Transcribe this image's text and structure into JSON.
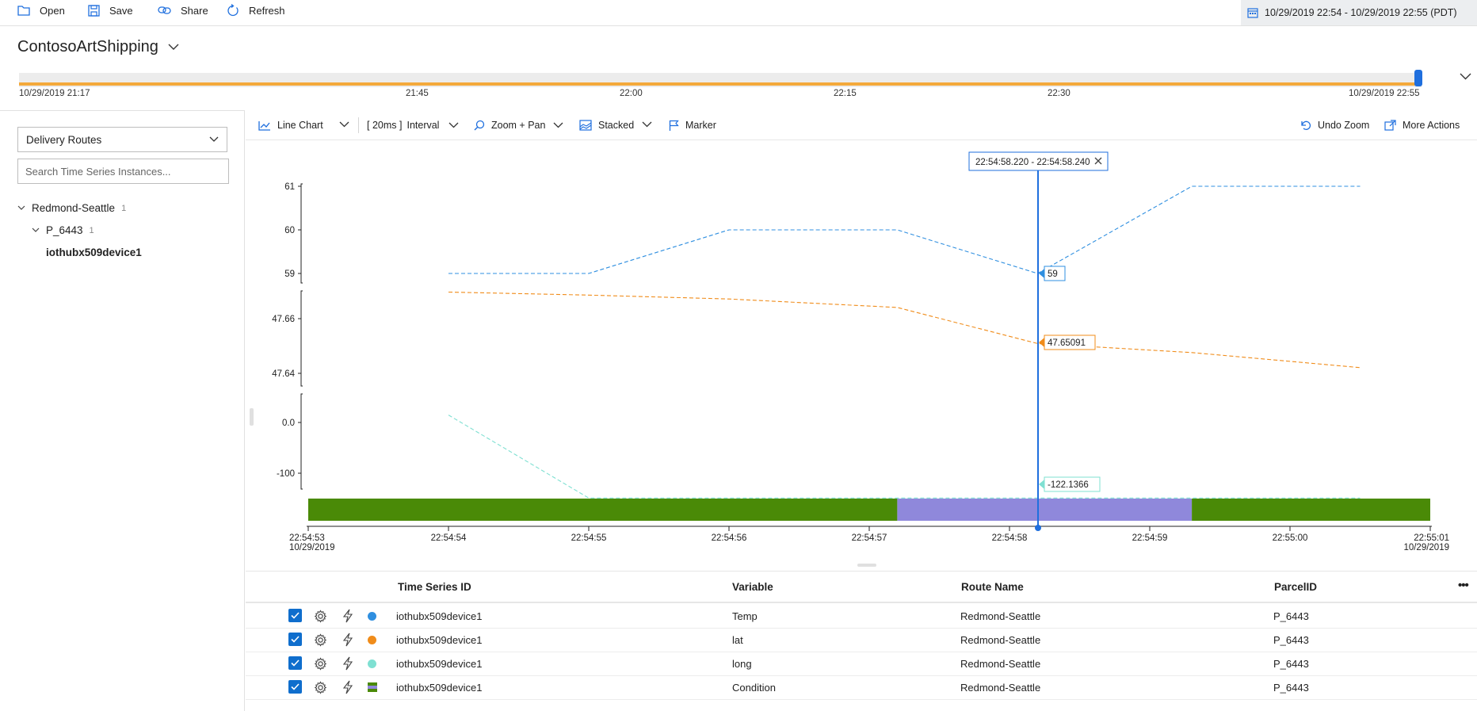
{
  "toolbar": {
    "open": "Open",
    "save": "Save",
    "share": "Share",
    "refresh": "Refresh",
    "date_range": "10/29/2019 22:54 - 10/29/2019 22:55 (PDT)"
  },
  "environment": {
    "name": "ContosoArtShipping"
  },
  "availability": {
    "labels": [
      "10/29/2019 21:17",
      "21:45",
      "22:00",
      "22:15",
      "22:30",
      "10/29/2019 22:55"
    ]
  },
  "left_panel": {
    "hierarchy": "Delivery Routes",
    "search_placeholder": "Search Time Series Instances...",
    "tree": [
      {
        "label": "Redmond-Seattle",
        "count": "1"
      },
      {
        "label": "P_6443",
        "count": "1"
      },
      {
        "label": "iothubx509device1"
      }
    ]
  },
  "chart_toolbar": {
    "line_chart": "Line Chart",
    "interval_value": "[ 20ms ]",
    "interval": "Interval",
    "zoom_pan": "Zoom + Pan",
    "stacked": "Stacked",
    "marker": "Marker",
    "undo_zoom": "Undo Zoom",
    "more_actions": "More Actions"
  },
  "chart_data": {
    "type": "line",
    "marker_range": "22:54:58.220 - 22:54:58.240",
    "x_ticks": [
      "22:54:53",
      "22:54:54",
      "22:54:55",
      "22:54:56",
      "22:54:57",
      "22:54:58",
      "22:54:59",
      "22:55:00",
      "22:55:01"
    ],
    "x_date_left": "10/29/2019",
    "x_date_right": "10/29/2019",
    "series": [
      {
        "name": "Temp",
        "color": "#2f8fe0",
        "x": [
          "22:54:54",
          "22:54:55",
          "22:54:56",
          "22:54:57.2",
          "22:54:58.2",
          "22:54:59.3",
          "22:55:00.5"
        ],
        "values": [
          59,
          59,
          60,
          60,
          59,
          61,
          61
        ],
        "y_ticks": [
          "61",
          "60",
          "59"
        ],
        "ylim": [
          59,
          61
        ],
        "marker_label": "59"
      },
      {
        "name": "lat",
        "color": "#f08c1a",
        "x": [
          "22:54:54",
          "22:54:55",
          "22:54:56",
          "22:54:57.2",
          "22:54:58.2",
          "22:54:59.3",
          "22:55:00.5"
        ],
        "values": [
          47.6697,
          47.6686,
          47.6672,
          47.6641,
          47.6509,
          47.6476,
          47.6421
        ],
        "y_ticks": [
          "47.66",
          "47.64"
        ],
        "marker_label": "47.65091"
      },
      {
        "name": "long",
        "color": "#7fe0d2",
        "x": [
          "22:54:54",
          "22:54:55",
          "22:54:56",
          "22:54:57.2",
          "22:54:58.2",
          "22:54:59.3",
          "22:55:00.5"
        ],
        "values": [
          12,
          -122.1366,
          -122.1366,
          -122.1366,
          -122.1366,
          -122.1366,
          -122.1366
        ],
        "y_ticks": [
          "0.0",
          "-100"
        ],
        "marker_label": "-122.1366"
      },
      {
        "name": "Condition",
        "type": "categorical",
        "segments": [
          {
            "from": "22:54:53",
            "to": "22:54:57.2",
            "color": "#4a8a07"
          },
          {
            "from": "22:54:57.2",
            "to": "22:54:59.3",
            "color": "#8f88db"
          },
          {
            "from": "22:54:59.3",
            "to": "22:55:01",
            "color": "#4a8a07"
          }
        ]
      }
    ]
  },
  "table": {
    "headers": [
      "Time Series ID",
      "Variable",
      "Route Name",
      "ParcelID"
    ],
    "more": "•••",
    "rows": [
      {
        "id": "iothubx509device1",
        "variable": "Temp",
        "route": "Redmond-Seattle",
        "parcel": "P_6443",
        "color": "#2f8fe0"
      },
      {
        "id": "iothubx509device1",
        "variable": "lat",
        "route": "Redmond-Seattle",
        "parcel": "P_6443",
        "color": "#f08c1a"
      },
      {
        "id": "iothubx509device1",
        "variable": "long",
        "route": "Redmond-Seattle",
        "parcel": "P_6443",
        "color": "#7fe0d2"
      },
      {
        "id": "iothubx509device1",
        "variable": "Condition",
        "route": "Redmond-Seattle",
        "parcel": "P_6443",
        "color": "condition"
      }
    ]
  }
}
